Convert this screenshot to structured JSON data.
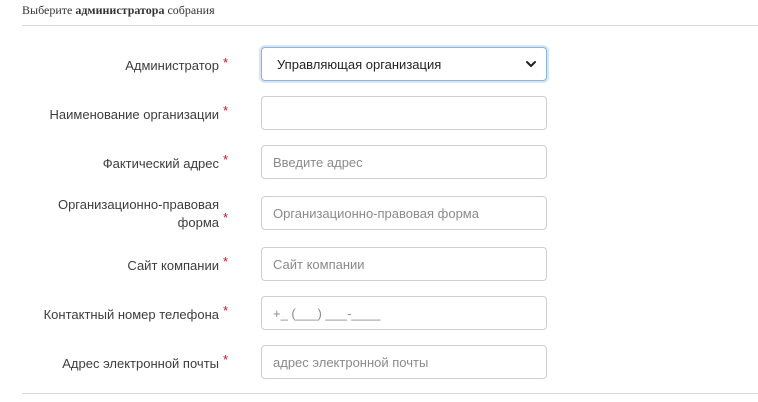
{
  "header": {
    "prefix": "Выберите ",
    "bold": "администратора",
    "suffix": " собрания"
  },
  "form": {
    "required_mark": "*",
    "administrator": {
      "label": "Администратор",
      "value": "Управляющая организация"
    },
    "org_name": {
      "label": "Наименование организации",
      "value": "",
      "placeholder": ""
    },
    "address": {
      "label": "Фактический адрес",
      "placeholder": "Введите адрес"
    },
    "legal_form": {
      "label_line1": "Организационно-правовая",
      "label_line2": "форма",
      "placeholder": "Организационно-правовая форма"
    },
    "website": {
      "label": "Сайт компании",
      "placeholder": "Сайт компании"
    },
    "phone": {
      "label": "Контактный номер телефона",
      "placeholder": "+_ (___) ___-____"
    },
    "email": {
      "label": "Адрес электронной почты",
      "placeholder": "адрес электронной почты"
    }
  }
}
